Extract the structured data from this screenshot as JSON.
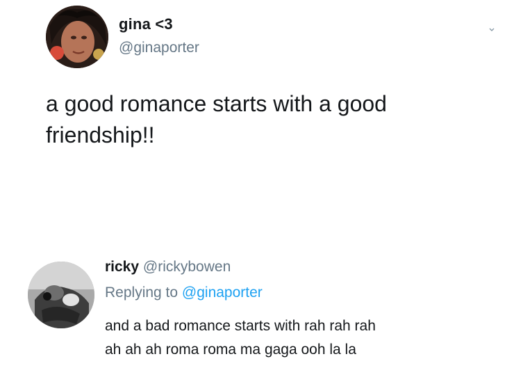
{
  "main_tweet": {
    "display_name": "gina <3",
    "handle": "@ginaporter",
    "text_line1": "a good romance starts with a good",
    "text_line2": "friendship!!",
    "avatar_icon": "profile-photo"
  },
  "reply": {
    "display_name": "ricky",
    "handle": "@rickybowen",
    "replying_to_prefix": "Replying to",
    "replying_to_handle": "@ginaporter",
    "text_line1": "and a bad romance starts with rah rah rah",
    "text_line2": "ah ah ah roma roma ma gaga ooh la la",
    "avatar_icon": "profile-photo-bw"
  },
  "colors": {
    "text": "#14171a",
    "secondary": "#657786",
    "link": "#1da1f2",
    "background": "#ffffff"
  }
}
